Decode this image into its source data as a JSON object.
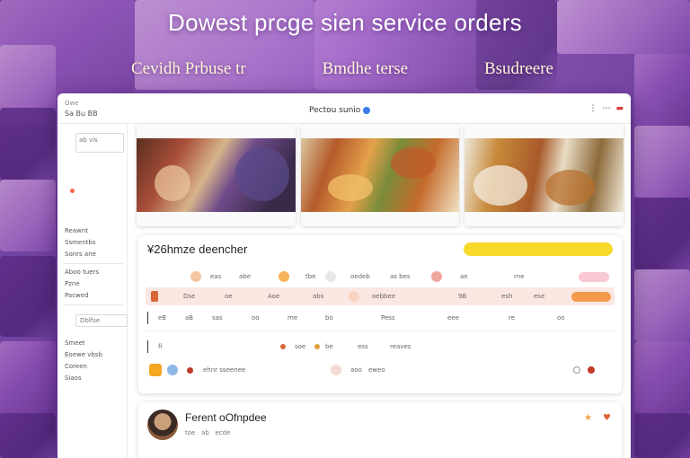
{
  "hero": {
    "headline": "Dowest prcge sien service orders",
    "subhead": [
      "Cevidh Prbuse tr",
      "Bmdhe terse",
      "Bsudreere"
    ]
  },
  "window": {
    "app_name": "Owe",
    "app_label": "Sa Bu BB",
    "title": "Pectou sunio",
    "controls": [
      "⋮",
      "⋯",
      "▬"
    ]
  },
  "sidebar": {
    "box_label": "ab vis",
    "items": [
      "Reawnt",
      "Ssmentbs",
      "Sonrs ane",
      "Aboo tuers",
      "Pzne",
      "Pacwed"
    ],
    "button_label": "Dblfse",
    "items2": [
      "Smeet",
      "Eoewe vbsb",
      "Coreen",
      "Siaos"
    ]
  },
  "images": [
    {
      "alt": "market stall photo"
    },
    {
      "alt": "food platter photo"
    },
    {
      "alt": "menu and dishes photo"
    }
  ],
  "orders": {
    "title": "¥26hmze deencher",
    "rows": [
      {
        "cells": [
          "eas",
          "abe",
          "tbe",
          "oedeb",
          "as bes",
          "ae",
          "rne"
        ]
      },
      {
        "cells": [
          "Dse",
          "oe",
          "Aoe",
          "abs",
          "oebbee",
          "9B",
          "esh",
          "ese"
        ]
      },
      {
        "cells": [
          "eB",
          "aB",
          "sas",
          "oo",
          "me",
          "bo",
          "Pess",
          "eee",
          "re",
          "oo"
        ]
      },
      {
        "cells": [
          "fi",
          "soe",
          "be",
          "ess",
          "reaves"
        ]
      },
      {
        "cells": [
          "ehnr sseenee",
          "aoo",
          "eweo"
        ]
      }
    ]
  },
  "profile": {
    "title": "Ferent oOfnpdee",
    "meta": [
      "toe",
      "ab",
      "ecde"
    ]
  },
  "colors": {
    "accent_yellow": "#f7d92a",
    "accent_orange": "#f39a4e",
    "accent_red": "#e23b3b",
    "accent_blue": "#3b7cf0",
    "bg_purple": "#7a4aa6"
  }
}
